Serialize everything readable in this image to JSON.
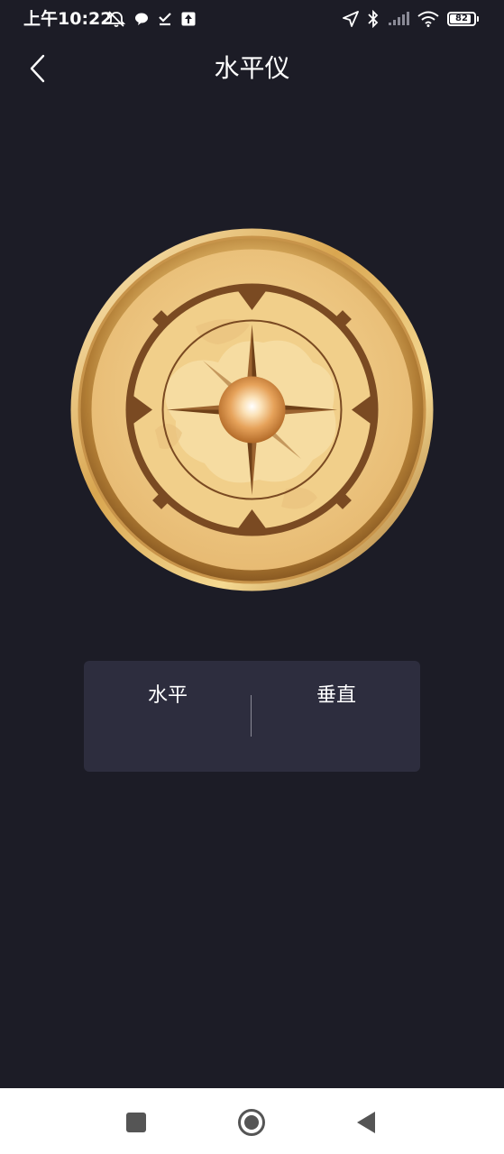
{
  "status_bar": {
    "time": "上午10:22",
    "battery_level": "82",
    "icons": [
      "alarm-off-icon",
      "chat-bubble-icon",
      "check-list-icon",
      "upload-icon",
      "location-arrow-icon",
      "bluetooth-icon",
      "signal-icon",
      "wifi-icon",
      "battery-icon"
    ]
  },
  "header": {
    "title": "水平仪",
    "back_icon": "chevron-left-icon"
  },
  "compass": {
    "icon": "compass-icon"
  },
  "mode_panel": {
    "horizontal_label": "水平",
    "vertical_label": "垂直"
  },
  "nav_bar": {
    "icons": [
      "recent-apps-icon",
      "home-icon",
      "back-icon"
    ]
  },
  "colors": {
    "background": "#1c1c26",
    "panel": "#2d2d3e",
    "gold": "#e8c07c",
    "dark_brown": "#7a4a22",
    "nav_bar": "#ffffff"
  }
}
